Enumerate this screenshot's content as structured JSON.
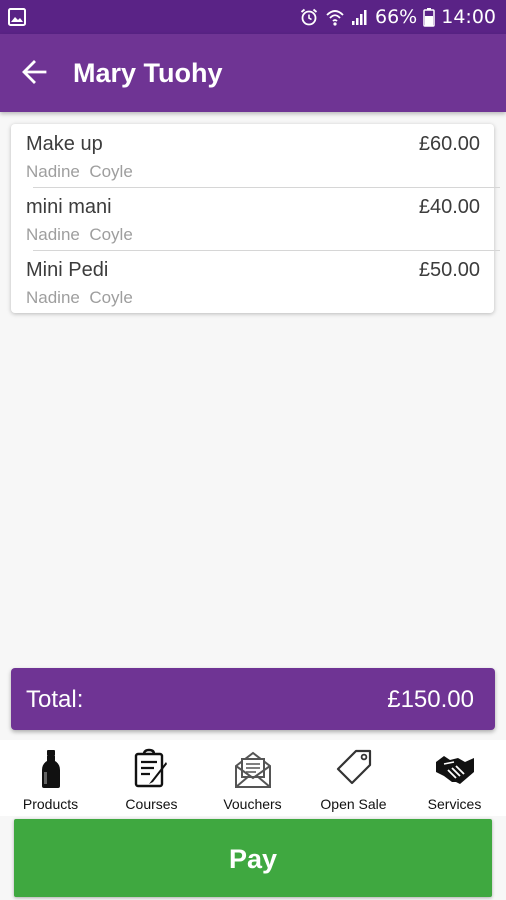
{
  "status_bar": {
    "battery_percent": "66%",
    "time": "14:00",
    "left_icon": "gallery-icon",
    "right_icons": [
      "alarm-icon",
      "wifi-icon",
      "signal-icon",
      "battery-icon"
    ]
  },
  "header": {
    "title": "Mary Tuohy",
    "back_icon": "back-arrow-icon"
  },
  "items": [
    {
      "name": "Make up",
      "price": "£60.00",
      "staff": "Nadine  Coyle"
    },
    {
      "name": "mini mani",
      "price": "£40.00",
      "staff": "Nadine  Coyle"
    },
    {
      "name": "Mini Pedi",
      "price": "£50.00",
      "staff": "Nadine  Coyle"
    }
  ],
  "total": {
    "label": "Total:",
    "value": "£150.00"
  },
  "bottom_nav": [
    {
      "label": "Products",
      "icon": "bottle-icon"
    },
    {
      "label": "Courses",
      "icon": "clipboard-pencil-icon"
    },
    {
      "label": "Vouchers",
      "icon": "envelope-letter-icon"
    },
    {
      "label": "Open Sale",
      "icon": "price-tag-icon"
    },
    {
      "label": "Services",
      "icon": "handshake-icon"
    }
  ],
  "pay_button": {
    "label": "Pay"
  },
  "colors": {
    "status_bar": "#5a2386",
    "primary": "#6f3494",
    "pay_green": "#3fa840",
    "background": "#f7f7f7"
  }
}
